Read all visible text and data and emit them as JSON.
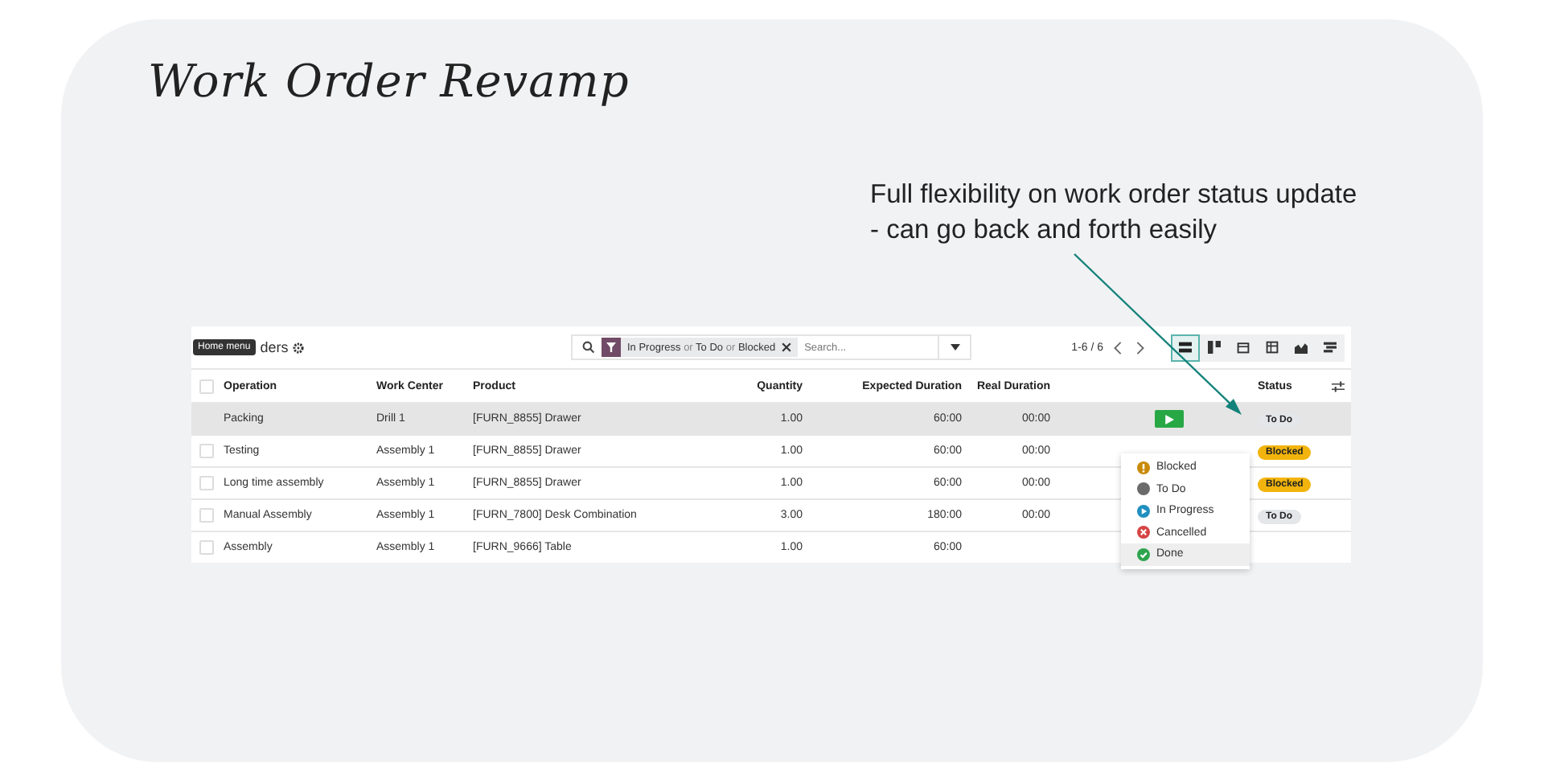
{
  "title": "Work Order Revamp",
  "annotation": "Full flexibility on work order status update - can go back and forth easily",
  "app": {
    "breadcrumb": "ders",
    "tooltip": "Home menu",
    "search": {
      "facets": [
        {
          "text": "In Progress",
          "kind": "value"
        },
        {
          "text": "or",
          "kind": "joiner"
        },
        {
          "text": "To Do",
          "kind": "value"
        },
        {
          "text": "or",
          "kind": "joiner"
        },
        {
          "text": "Blocked",
          "kind": "value"
        }
      ],
      "placeholder": "Search..."
    },
    "pager": "1-6 / 6",
    "select_all": {
      "checked": false
    },
    "views": [
      {
        "kind": "list",
        "selected": true
      },
      {
        "kind": "kanban",
        "selected": false
      },
      {
        "kind": "calendar",
        "selected": false
      },
      {
        "kind": "pivot",
        "selected": false
      },
      {
        "kind": "graph",
        "selected": false
      },
      {
        "kind": "gantt",
        "selected": false
      }
    ],
    "columns": [
      "Operation",
      "Work Center",
      "Product",
      "Quantity",
      "Expected Duration",
      "Real Duration",
      "Status"
    ],
    "rows": [
      {
        "highlighted": true,
        "operation": "Packing",
        "work_center": "Drill 1",
        "product": "[FURN_8855] Drawer",
        "quantity": "1.00",
        "expected": "60:00",
        "real": "00:00",
        "play": true,
        "status": {
          "text": "To Do",
          "color": "#e4e6e9"
        }
      },
      {
        "highlighted": false,
        "checked": false,
        "operation": "Testing",
        "work_center": "Assembly 1",
        "product": "[FURN_8855] Drawer",
        "quantity": "1.00",
        "expected": "60:00",
        "real": "00:00",
        "play": false,
        "status": {
          "text": "Blocked",
          "color": "#f2b40c"
        }
      },
      {
        "highlighted": false,
        "checked": false,
        "operation": "Long time assembly",
        "work_center": "Assembly 1",
        "product": "[FURN_8855] Drawer",
        "quantity": "1.00",
        "expected": "60:00",
        "real": "00:00",
        "play": false,
        "status": {
          "text": "Blocked",
          "color": "#f2b40c"
        }
      },
      {
        "highlighted": false,
        "checked": false,
        "operation": "Manual Assembly",
        "work_center": "Assembly 1",
        "product": "[FURN_7800] Desk Combination",
        "quantity": "3.00",
        "expected": "180:00",
        "real": "00:00",
        "play": false,
        "status": {
          "text": "To Do",
          "color": "#e4e6e9"
        }
      },
      {
        "highlighted": false,
        "checked": false,
        "operation": "Assembly",
        "work_center": "Assembly 1",
        "product": "[FURN_9666] Table",
        "quantity": "1.00",
        "expected": "60:00",
        "play": false
      }
    ],
    "menu": [
      {
        "label": "Blocked",
        "kind": "blocked",
        "color": "#c98a0a",
        "selected": false
      },
      {
        "label": "To Do",
        "kind": "todo",
        "color": "#6b6b6b",
        "selected": false
      },
      {
        "label": "In Progress",
        "kind": "progress",
        "color": "#1f8fbf",
        "selected": false
      },
      {
        "label": "Cancelled",
        "kind": "cancelled",
        "color": "#d64545",
        "selected": false
      },
      {
        "label": "Done",
        "kind": "done",
        "color": "#2ea44f",
        "selected": true
      }
    ]
  }
}
